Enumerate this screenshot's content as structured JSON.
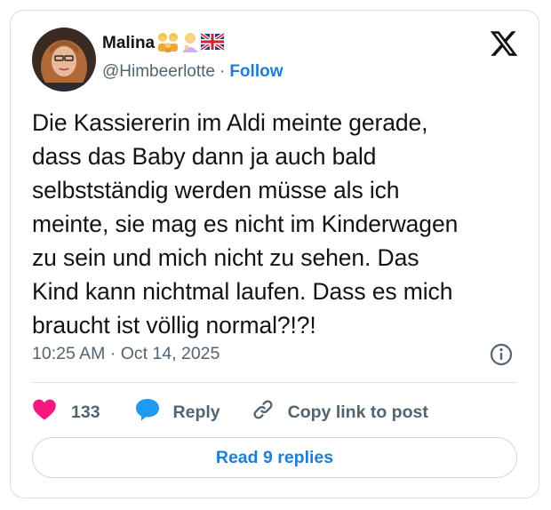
{
  "author": {
    "display_name": "Malina",
    "handle": "@Himbeerlotte",
    "separator": "·",
    "follow_label": "Follow",
    "badges": [
      "family-emoji-icon",
      "person-blond-emoji-icon",
      "uk-flag-icon"
    ]
  },
  "tweet": {
    "text": "Die Kassiererin im Aldi meinte gerade,\ndass das Baby dann ja auch bald\nselbstständig werden müsse als ich\nmeinte, sie mag es nicht im Kinderwagen\nzu sein und mich nicht zu sehen. Das\nKind kann nichtmal laufen. Dass es mich\nbraucht ist völlig normal?!?!",
    "timestamp": "10:25 AM · Oct 14, 2025"
  },
  "actions": {
    "like_count": "133",
    "reply_label": "Reply",
    "copy_label": "Copy link to post"
  },
  "footer": {
    "read_replies_label": "Read 9 replies"
  },
  "colors": {
    "accent": "#1d7ed6",
    "like": "#f91880",
    "reply_bubble": "#1d9bf0",
    "text": "#0f1419",
    "muted": "#536471"
  }
}
